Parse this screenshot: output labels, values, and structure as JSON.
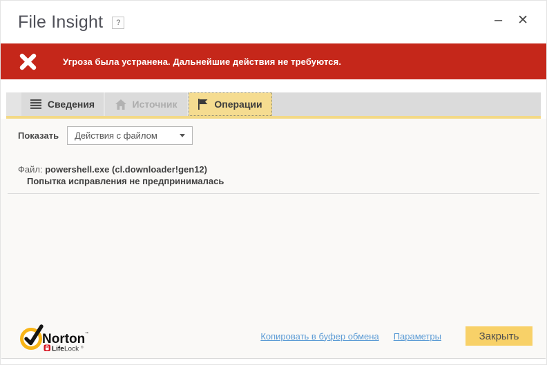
{
  "window": {
    "title": "File Insight",
    "help_label": "?",
    "minimize_glyph": "–",
    "close_glyph": "✕"
  },
  "banner": {
    "message": "Угроза была устранена. Дальнейшие действия не требуются.",
    "background_color": "#c5271a",
    "icon": "x-mark-icon"
  },
  "tabs": [
    {
      "label": "Сведения",
      "icon": "list-icon",
      "state": "normal"
    },
    {
      "label": "Источник",
      "icon": "home-icon",
      "state": "disabled"
    },
    {
      "label": "Операции",
      "icon": "flag-icon",
      "state": "active"
    }
  ],
  "filter": {
    "label": "Показать",
    "dropdown_value": "Действия с файлом"
  },
  "details": {
    "file_label": "Файл:",
    "file_value": "powershell.exe (cl.downloader!gen12)",
    "status_line": "Попытка исправления не предпринималась"
  },
  "footer": {
    "brand": {
      "name": "Norton",
      "tm": "™",
      "life": "Life",
      "lock": "Lock",
      "reg": "®"
    },
    "links": [
      {
        "label": "Копировать в буфер обмена"
      },
      {
        "label": "Параметры"
      }
    ],
    "close_button_label": "Закрыть"
  },
  "colors": {
    "banner_red": "#c5271a",
    "active_tab_yellow": "#f5dc90",
    "underline_yellow": "#f3d986",
    "button_yellow": "#f8d168",
    "link_blue": "#5b9bd5",
    "norton_ring_yellow": "#f9b517",
    "lifelock_red": "#d6101d"
  }
}
